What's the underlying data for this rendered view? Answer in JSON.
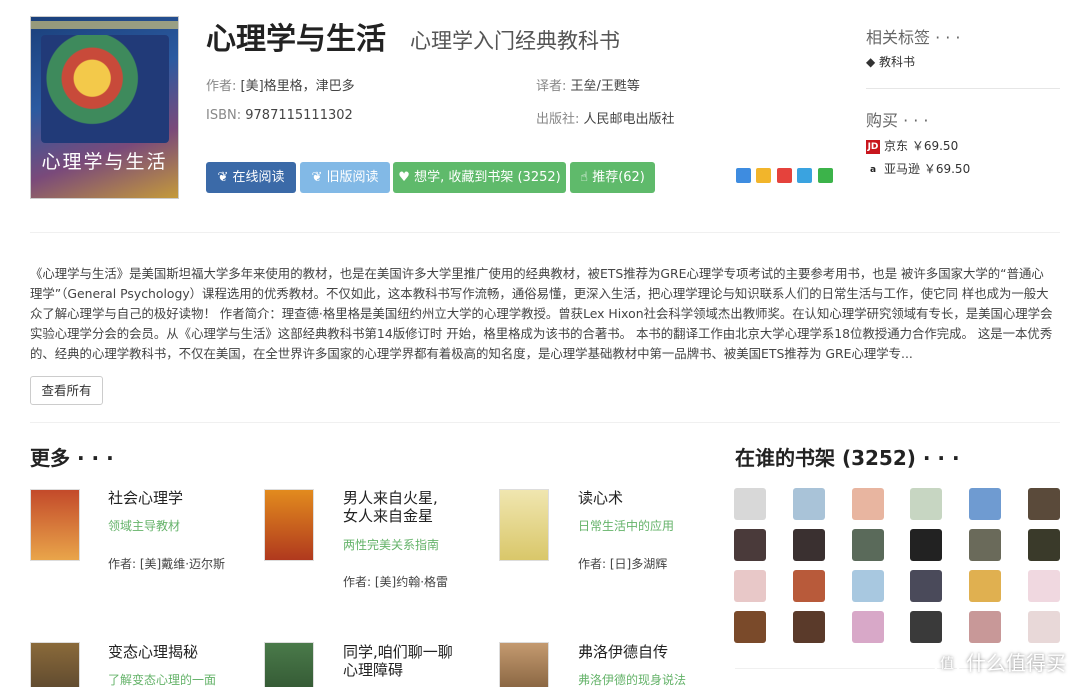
{
  "book": {
    "title": "心理学与生活",
    "subtitle": "心理学入门经典教科书",
    "cover_title": "心理学与生活",
    "author_label": "作者:",
    "author": "[美]格里格，津巴多",
    "translator_label": "译者:",
    "translator": "王垒/王甦等",
    "isbn_label": "ISBN:",
    "isbn": "9787115111302",
    "publisher_label": "出版社:",
    "publisher": "人民邮电出版社"
  },
  "actions": {
    "online_read": "在线阅读",
    "old_read": "旧版阅读",
    "want": "想学, 收藏到书架 (3252)",
    "recommend": "推荐(62)"
  },
  "share_icons": [
    "qzone-icon",
    "star-icon",
    "weibo-icon",
    "qq-icon",
    "wechat-icon"
  ],
  "tags_section": {
    "heading": "相关标签 · · ·",
    "tags": [
      "教科书"
    ]
  },
  "buy_section": {
    "heading": "购买 · · ·",
    "stores": [
      {
        "badge": "JD",
        "name": "京东",
        "price": "￥69.50",
        "color": "#c8161d"
      },
      {
        "badge": "a",
        "name": "亚马逊",
        "price": "￥69.50",
        "color": "#222222"
      }
    ]
  },
  "description": "《心理学与生活》是美国斯坦福大学多年来使用的教材，也是在美国许多大学里推广使用的经典教材，被ETS推荐为GRE心理学专项考试的主要参考用书，也是 被许多国家大学的“普通心理学”（General Psychology）课程选用的优秀教材。不仅如此，这本教科书写作流畅，通俗易懂，更深入生活，把心理学理论与知识联系人们的日常生活与工作，使它同 样也成为一般大众了解心理学与自己的极好读物！ 作者简介：理查德·格里格是美国纽约州立大学的心理学教授。曾获Lex Hixon社会科学领域杰出教师奖。在认知心理学研究领域有专长，是美国心理学会实验心理学分会的会员。从《心理学与生活》这部经典教科书第14版修订时 开始，格里格成为该书的合著书。 本书的翻译工作由北京大学心理学系18位教授通力合作完成。 这是一本优秀的、经典的心理学教科书，不仅在美国，在全世界许多国家的心理学界都有着极高的知名度，是心理学基础教材中第一品牌书、被美国ETS推荐为 GRE心理学专...",
  "view_all": "查看所有",
  "more_section": {
    "heading": "更多 · · ·",
    "books": [
      {
        "name": "社会心理学",
        "tag": "领域主导教材",
        "author": "作者: [美]戴维·迈尔斯",
        "color": "#b0562e"
      },
      {
        "name": "男人来自火星, 女人来自金星",
        "tag": "两性完美关系指南",
        "author": "作者: [美]约翰·格雷",
        "color": "#c8741f"
      },
      {
        "name": "读心术",
        "tag": "日常生活中的应用",
        "author": "作者: [日]多湖辉",
        "color": "#d9c76a"
      },
      {
        "name": "变态心理揭秘",
        "tag": "了解变态心理的一面",
        "author": "",
        "color": "#6b4f2a"
      },
      {
        "name": "同学,咱们聊一聊 心理障碍",
        "tag": "",
        "author": "",
        "color": "#3d6b3a"
      },
      {
        "name": "弗洛伊德自传",
        "tag": "弗洛伊德的现身说法",
        "author": "",
        "color": "#8a5a3c"
      }
    ]
  },
  "shelf_section": {
    "heading": "在谁的书架 (3252) · · ·",
    "avatar_colors": [
      "#d8d8d8",
      "#a9c3d8",
      "#e8b5a0",
      "#c7d6c2",
      "#6f9bd1",
      "#5a4a3a",
      "#4a3a3a",
      "#3a3030",
      "#5a6a5a",
      "#222222",
      "#6a6a5a",
      "#3a3a2a",
      "#e8c8c8",
      "#b85a3a",
      "#a8c8e0",
      "#4a4a5a",
      "#e0b050",
      "#f0d8e0",
      "#7a4a2a",
      "#5a3a2a",
      "#d8a8c8",
      "#3a3a3a",
      "#c89898",
      "#e8d8d8"
    ]
  },
  "watermark": "什么值得买"
}
